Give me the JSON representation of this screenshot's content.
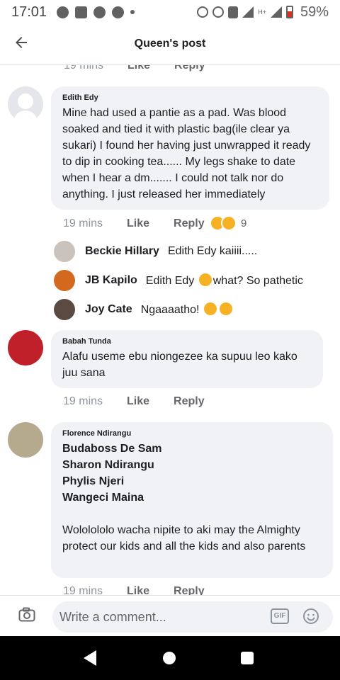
{
  "status_bar": {
    "time": "17:01",
    "battery": "59%",
    "battery_level": 0.59,
    "network": "H+"
  },
  "header": {
    "title": "Queen's post"
  },
  "actions": {
    "like": "Like",
    "reply": "Reply"
  },
  "top_partial": {
    "time": "19 mins"
  },
  "comments": [
    {
      "author": "Edith Edy",
      "text": "Mine had used a pantie as a pad. Was blood soaked and tied it with plastic bag(ile clear ya sukari) I found her having just unwrapped it ready to dip in cooking tea...... My legs shake to date when I hear a dm....... I could not talk nor do anything. I just released her immediately",
      "time": "19 mins",
      "reaction_count": "9",
      "replies": [
        {
          "author": "Beckie Hillary",
          "text": "Edith Edy kaiiii....."
        },
        {
          "author": "JB Kapilo",
          "text_before": "Edith Edy",
          "text_after": "what?  So pathetic"
        },
        {
          "author": "Joy Cate",
          "text": "Ngaaaatho!"
        }
      ]
    },
    {
      "author": "Babah Tunda",
      "text": "Alafu useme ebu niongezee ka supuu leo kako juu sana",
      "time": "19 mins"
    },
    {
      "author": "Florence Ndirangu",
      "mentions": [
        "Budaboss De Sam",
        "Sharon Ndirangu",
        "Phylis Njeri",
        "Wangeci Maina"
      ],
      "text": "Wololololo wacha nipite to aki may the Almighty protect our kids and all the kids and also parents",
      "time": "19 mins"
    }
  ],
  "composer": {
    "placeholder": "Write a comment...",
    "gif_label": "GIF"
  },
  "icons": {
    "back": "arrow-left-icon",
    "camera": "camera-icon",
    "gif": "gif-icon",
    "emoji": "emoji-icon"
  },
  "colors": {
    "bubble_bg": "#f0f2f5",
    "meta_text": "#65676b",
    "text": "#1c1e21",
    "reaction_yellow": "#f7b125"
  }
}
